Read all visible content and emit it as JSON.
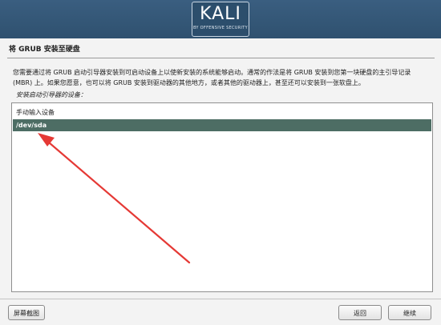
{
  "logo": {
    "main": "KALI",
    "sub": "BY OFFENSIVE SECURITY"
  },
  "step": {
    "title": "将 GRUB 安装至硬盘"
  },
  "description": {
    "line1": "您需要通过将 GRUB 启动引导器安装到可启动设备上以使新安装的系统能够启动。通常的作法是将 GRUB 安装到您第一块硬盘的主引导记录",
    "line2": "(MBR) 上。如果您愿意，也可以将 GRUB 安装到驱动器的其他地方，或者其他的驱动器上，甚至还可以安装到一张软盘上。"
  },
  "prompt": "安装启动引导器的设备：",
  "devices": {
    "manual": "手动输入设备",
    "selected": "/dev/sda"
  },
  "buttons": {
    "screenshot": "屏幕截图",
    "back": "返回",
    "continue": "继续"
  },
  "colors": {
    "banner": "#2f516f",
    "selection": "#4d6d64",
    "annotation_arrow": "#e53935"
  }
}
